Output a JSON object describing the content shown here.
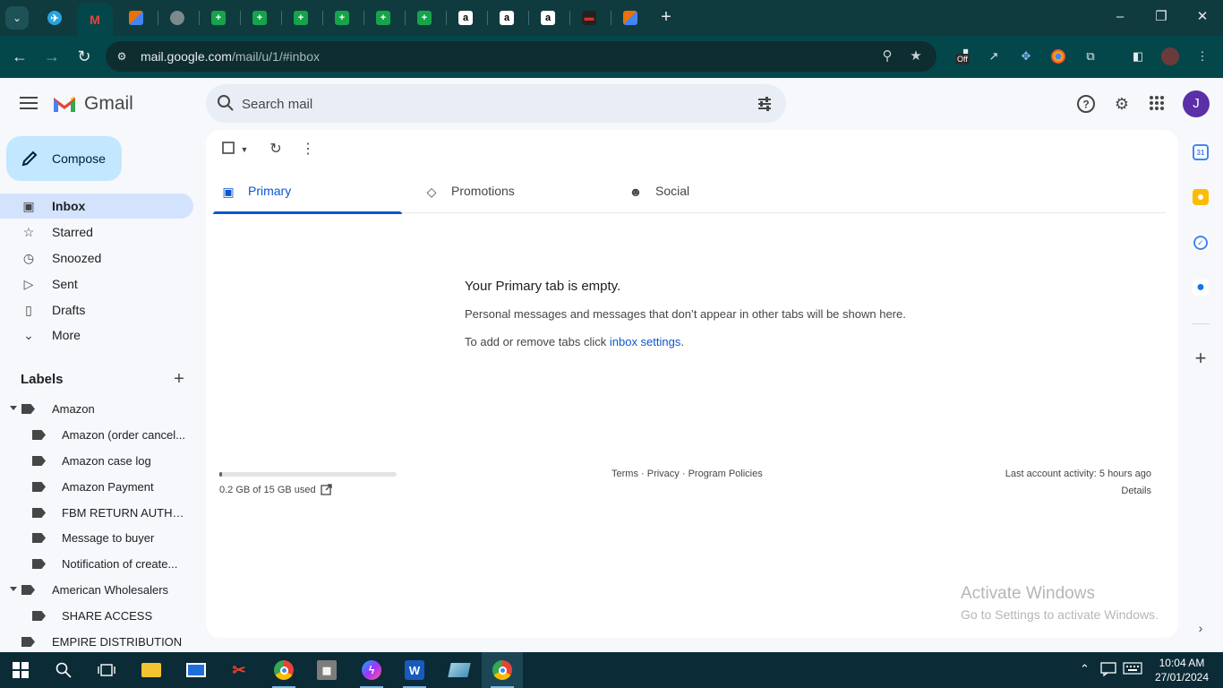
{
  "browser": {
    "url_host": "mail.google.com",
    "url_path": "/mail/u/1/#inbox",
    "tabs": [
      {
        "name": "telegram",
        "glyph": "✈",
        "color": "#2aa3df"
      },
      {
        "name": "gmail",
        "glyph": "M",
        "color": "#ea4335"
      },
      {
        "name": "app-stripes",
        "glyph": "▞",
        "color": "#e8710a"
      },
      {
        "name": "globe",
        "glyph": "●",
        "color": "#7b8a8c"
      },
      {
        "name": "sheets-1",
        "glyph": "+",
        "color": "#16a34a"
      },
      {
        "name": "sheets-2",
        "glyph": "+",
        "color": "#16a34a"
      },
      {
        "name": "sheets-3",
        "glyph": "+",
        "color": "#16a34a"
      },
      {
        "name": "sheets-4",
        "glyph": "+",
        "color": "#16a34a"
      },
      {
        "name": "sheets-5",
        "glyph": "+",
        "color": "#16a34a"
      },
      {
        "name": "sheets-6",
        "glyph": "+",
        "color": "#16a34a"
      },
      {
        "name": "amazon-1",
        "glyph": "a",
        "color": "#ffffff"
      },
      {
        "name": "amazon-2",
        "glyph": "a",
        "color": "#ffffff"
      },
      {
        "name": "amazon-3",
        "glyph": "a",
        "color": "#ffffff"
      },
      {
        "name": "red-bar",
        "glyph": "▬",
        "color": "#d93025"
      },
      {
        "name": "app-stripes-2",
        "glyph": "▞",
        "color": "#e8710a"
      }
    ],
    "ext_off_badge": "Off"
  },
  "gmail": {
    "brand": "Gmail",
    "search_placeholder": "Search mail",
    "avatar_initial": "J",
    "compose_label": "Compose",
    "nav": [
      {
        "key": "inbox",
        "label": "Inbox",
        "icon": "inbox-icon",
        "glyph": "▣",
        "active": true
      },
      {
        "key": "starred",
        "label": "Starred",
        "icon": "star-icon",
        "glyph": "☆",
        "active": false
      },
      {
        "key": "snoozed",
        "label": "Snoozed",
        "icon": "clock-icon",
        "glyph": "◷",
        "active": false
      },
      {
        "key": "sent",
        "label": "Sent",
        "icon": "send-icon",
        "glyph": "▷",
        "active": false
      },
      {
        "key": "drafts",
        "label": "Drafts",
        "icon": "draft-icon",
        "glyph": "▯",
        "active": false
      },
      {
        "key": "more",
        "label": "More",
        "icon": "chevron-down-icon",
        "glyph": "⌄",
        "active": false
      }
    ],
    "labels_title": "Labels",
    "labels": [
      {
        "label": "Amazon",
        "level": 0,
        "expanded": true
      },
      {
        "label": "Amazon (order cancel...",
        "level": 1
      },
      {
        "label": "Amazon case log",
        "level": 1
      },
      {
        "label": "Amazon Payment",
        "level": 1
      },
      {
        "label": "FBM RETURN AUTH B...",
        "level": 1
      },
      {
        "label": "Message to buyer",
        "level": 1
      },
      {
        "label": "Notification of create...",
        "level": 1
      },
      {
        "label": "American Wholesalers",
        "level": 0,
        "expanded": true
      },
      {
        "label": "SHARE ACCESS",
        "level": 1
      },
      {
        "label": "EMPIRE DISTRIBUTION",
        "level": 0,
        "expanded": false
      }
    ],
    "tabs": [
      {
        "key": "primary",
        "label": "Primary",
        "icon": "inbox-icon",
        "glyph": "▣",
        "active": true
      },
      {
        "key": "promotions",
        "label": "Promotions",
        "icon": "tag-icon",
        "glyph": "◇",
        "active": false
      },
      {
        "key": "social",
        "label": "Social",
        "icon": "people-icon",
        "glyph": "☻",
        "active": false
      }
    ],
    "empty": {
      "title": "Your Primary tab is empty.",
      "desc": "Personal messages and messages that don’t appear in other tabs will be shown here.",
      "settings_prefix": "To add or remove tabs click ",
      "settings_link": "inbox settings",
      "settings_suffix": "."
    },
    "storage": {
      "text": "0.2 GB of 15 GB used",
      "fraction": 0.013
    },
    "footer": {
      "terms": "Terms",
      "privacy": "Privacy",
      "policies": "Program Policies",
      "sep": " · "
    },
    "activity": {
      "text": "Last account activity: 5 hours ago",
      "details": "Details"
    }
  },
  "watermark": {
    "line1": "Activate Windows",
    "line2": "Go to Settings to activate Windows."
  },
  "taskbar": {
    "time": "10:04 AM",
    "date": "27/01/2024"
  },
  "colors": {
    "accent": "#0b57d0",
    "compose_bg": "#c2e7ff",
    "active_nav": "#d3e3fd",
    "browser_frame": "#04474a"
  }
}
